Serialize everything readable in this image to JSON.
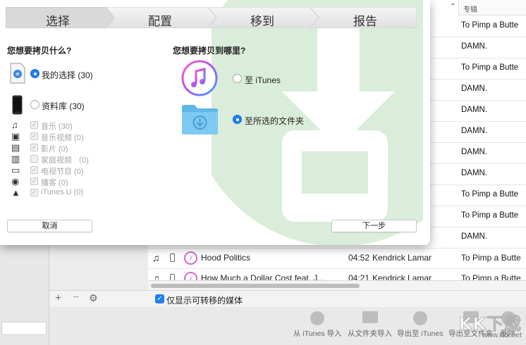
{
  "dialog": {
    "steps": [
      "选择",
      "配置",
      "移到",
      "报告"
    ],
    "what_title": "您想要拷贝什么?",
    "where_title": "您想要拷贝到哪里?",
    "options": {
      "my_selection": "我的选择 (30)",
      "library": "资料库 (30)"
    },
    "sub_items": [
      {
        "icon": "music-note-icon",
        "label": "音乐 (30)"
      },
      {
        "icon": "music-video-icon",
        "label": "音乐视频 (0)"
      },
      {
        "icon": "film-icon",
        "label": "影片 (0)"
      },
      {
        "icon": "home-video-icon",
        "label": "家庭视频 （0)"
      },
      {
        "icon": "tv-icon",
        "label": "电视节目 (0)"
      },
      {
        "icon": "podcast-icon",
        "label": "播客 (0)"
      },
      {
        "icon": "itunes-u-icon",
        "label": "iTunes U (0)"
      }
    ],
    "dest_itunes": "至 iTunes",
    "dest_folder": "至所选的文件夹",
    "cancel": "取消",
    "next": "下一步",
    "selected_what": "my_selection",
    "selected_where": "folder"
  },
  "table": {
    "album_header": "专辑",
    "albums": [
      "To Pimp a Butte",
      "DAMN.",
      "To Pimp a Butte",
      "DAMN.",
      "DAMN.",
      "DAMN.",
      "DAMN.",
      "DAMN.",
      "To Pimp a Butte",
      "To Pimp a Butte",
      "DAMN."
    ],
    "songs": [
      {
        "title": "Hood Politics",
        "time": "04:52",
        "artist": "Kendrick Lamar",
        "album": "To Pimp a Butte"
      },
      {
        "title": "How Much a Dollar Cost feat. J...",
        "time": "04:21",
        "artist": "Kendrick Lamar",
        "album": "To Pimp a Butte"
      }
    ]
  },
  "bottom": {
    "checkbox_label": "仅显示可转移的媒体"
  },
  "toolbar": {
    "import_itunes": "从 iTunes 导入",
    "import_folder": "从文件夹导入",
    "export_itunes": "导出至 iTunes",
    "export_folder": "导出至文件夹",
    "delete": "删除"
  },
  "watermark": {
    "logo": "KK下载",
    "url": "www.kkx.net"
  },
  "colors": {
    "accent": "#1e7ff0",
    "folder": "#6fc0ea",
    "bg_arrow": "#3a9a3a"
  }
}
